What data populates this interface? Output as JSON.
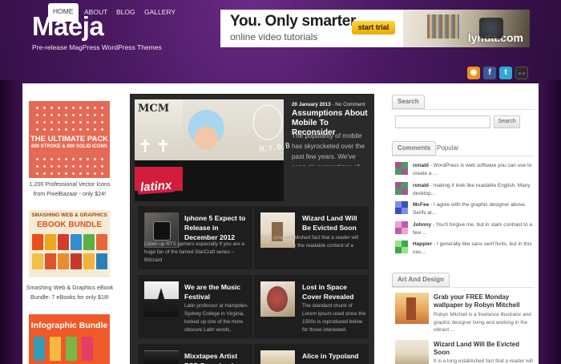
{
  "header": {
    "site_title": "Maeja",
    "tagline": "Pre-release MagPress WordPress Themes",
    "ad": {
      "line1": "You. Only smarter.",
      "line2": "online video tutorials",
      "button": "start trial",
      "brand": "lynda.com"
    }
  },
  "nav": {
    "items": [
      "HOME",
      "ABOUT",
      "BLOG",
      "GALLERY"
    ],
    "active": "HOME",
    "social": [
      {
        "icon": "rss-icon",
        "glyph": "◉",
        "color": "#e8921e"
      },
      {
        "icon": "facebook-icon",
        "glyph": "f",
        "color": "#3b5998"
      },
      {
        "icon": "twitter-icon",
        "glyph": "t",
        "color": "#33a7d8"
      },
      {
        "icon": "flickr-icon",
        "glyph": "●",
        "color": "#2a2a2a"
      }
    ]
  },
  "left_sidebar": {
    "ad1": {
      "title": "THE ULTIMATE PACK",
      "subtitle": "600 STROKE & 600 SOLID ICONS",
      "caption": "1,200 Professional Vector Icons from PixelBazaar - only $24!"
    },
    "ad2": {
      "line1": "SMASHING WEB & GRAPHICS",
      "line2": "EBOOK BUNDLE",
      "caption": "Smashing Web & Graphics eBook Bundle: 7 eBooks for only $18!"
    },
    "ad3": {
      "title": "Infographic Bundle"
    }
  },
  "featured": {
    "date": "20 January 2013",
    "comments": "No Comment",
    "title": "Assumptions About Mobile To Reconsider",
    "excerpt": "The popularity of mobile has skyrocketed over the past few years. We've seen six generations of iPhones, five",
    "image_text": {
      "mcm": "MCM",
      "crosses": "✝✝",
      "myob": "M.Y.O.B",
      "latin": "latinx"
    }
  },
  "posts": [
    {
      "title": "Iphone 5 Expect to Release in December 2012",
      "excerpt": "Listen up RTS gamers especially if you are a huge fan of the famed StarCraft series – Blizzard"
    },
    {
      "title": "Wizard Land Will Be Evicted Soon",
      "excerpt": "It is a long established fact that a reader will be distracted by the readable content of a"
    },
    {
      "title": "We are the Music Festival",
      "excerpt": "Latin professor at Hampden-Sydney College in Virginia, looked up one of the more obscure Latin words, consectetur, from"
    },
    {
      "title": "Lost in Space Cover Revealed",
      "excerpt": "The standard chunk of Lorem Ipsum used since the 1500s is reproduced below for those interested. Sections"
    },
    {
      "title": "Mixxtapes Artist PSD Download",
      "excerpt": ""
    },
    {
      "title": "Alice in Typoland",
      "excerpt": ""
    }
  ],
  "right_sidebar": {
    "search": {
      "heading": "Search",
      "placeholder": "",
      "button": "Search"
    },
    "tabs": [
      "Comments",
      "Popular"
    ],
    "comments": [
      {
        "author": "ronald",
        "text": " - WordPress is web software you can use to create a ..."
      },
      {
        "author": "ronald",
        "text": " - making it look like readable English. Many desktop..."
      },
      {
        "author": "McFee",
        "text": " - I agree with the graphic designer above. Serifs ar..."
      },
      {
        "author": "Johnny",
        "text": " - You'll forgive me, but in stark contrast to a few ..."
      },
      {
        "author": "Happier",
        "text": " - I generally like sans serif fonts, but in this cas..."
      }
    ],
    "art_design": {
      "heading": "Art And Design",
      "items": [
        {
          "title": "Grab your FREE Monday wallpaper by Robyn Mitchell",
          "excerpt": "Robyn Mitchell is a freelance illustrator and graphic designer living and working in the vibrant ..."
        },
        {
          "title": "Wizard Land Will Be Evicted Soon",
          "excerpt": "It is a long established fact that a reader will"
        }
      ]
    }
  }
}
